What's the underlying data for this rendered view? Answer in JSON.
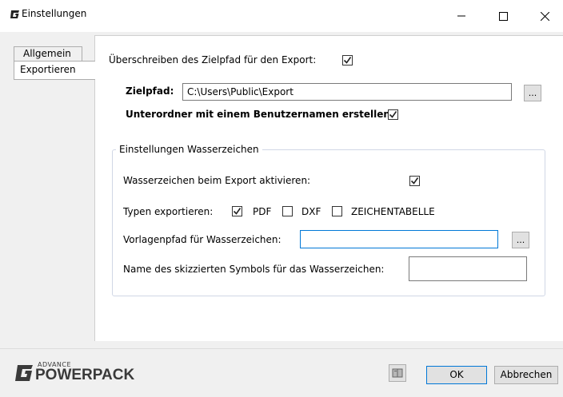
{
  "window": {
    "title": "Einstellungen",
    "minimize_icon": "minimize-icon",
    "maximize_icon": "maximize-icon",
    "close_icon": "close-icon"
  },
  "tabs": [
    {
      "label": "Allgemein",
      "selected": false
    },
    {
      "label": "Exportieren",
      "selected": true
    }
  ],
  "export": {
    "overwrite_label": "Überschreiben des Zielpfad für den Export:",
    "overwrite_checked": true,
    "zielpfad_label": "Zielpfad:",
    "zielpfad_value": "C:\\Users\\Public\\Export",
    "browse_label": "...",
    "subfolder_label": "Unterordner mit einem Benutzernamen erstellen:",
    "subfolder_checked": true
  },
  "watermark": {
    "group_title": "Einstellungen Wasserzeichen",
    "enable_label": "Wasserzeichen beim Export aktivieren:",
    "enable_checked": true,
    "types_label": "Typen exportieren:",
    "types": [
      {
        "label": "PDF",
        "checked": true
      },
      {
        "label": "DXF",
        "checked": false
      },
      {
        "label": "ZEICHENTABELLE",
        "checked": false
      }
    ],
    "template_label": "Vorlagenpfad für Wasserzeichen:",
    "template_value": "",
    "browse_label": "...",
    "symbol_label": "Name des skizzierten Symbols für das Wasserzeichen:",
    "symbol_value": ""
  },
  "footer": {
    "logo_small": "ADVANCE",
    "logo_big": "POWERPACK",
    "help_icon": "book-help-icon",
    "ok_label": "OK",
    "cancel_label": "Abbrechen"
  },
  "colors": {
    "accent": "#0078d7",
    "logo": "#3a3a3a"
  }
}
